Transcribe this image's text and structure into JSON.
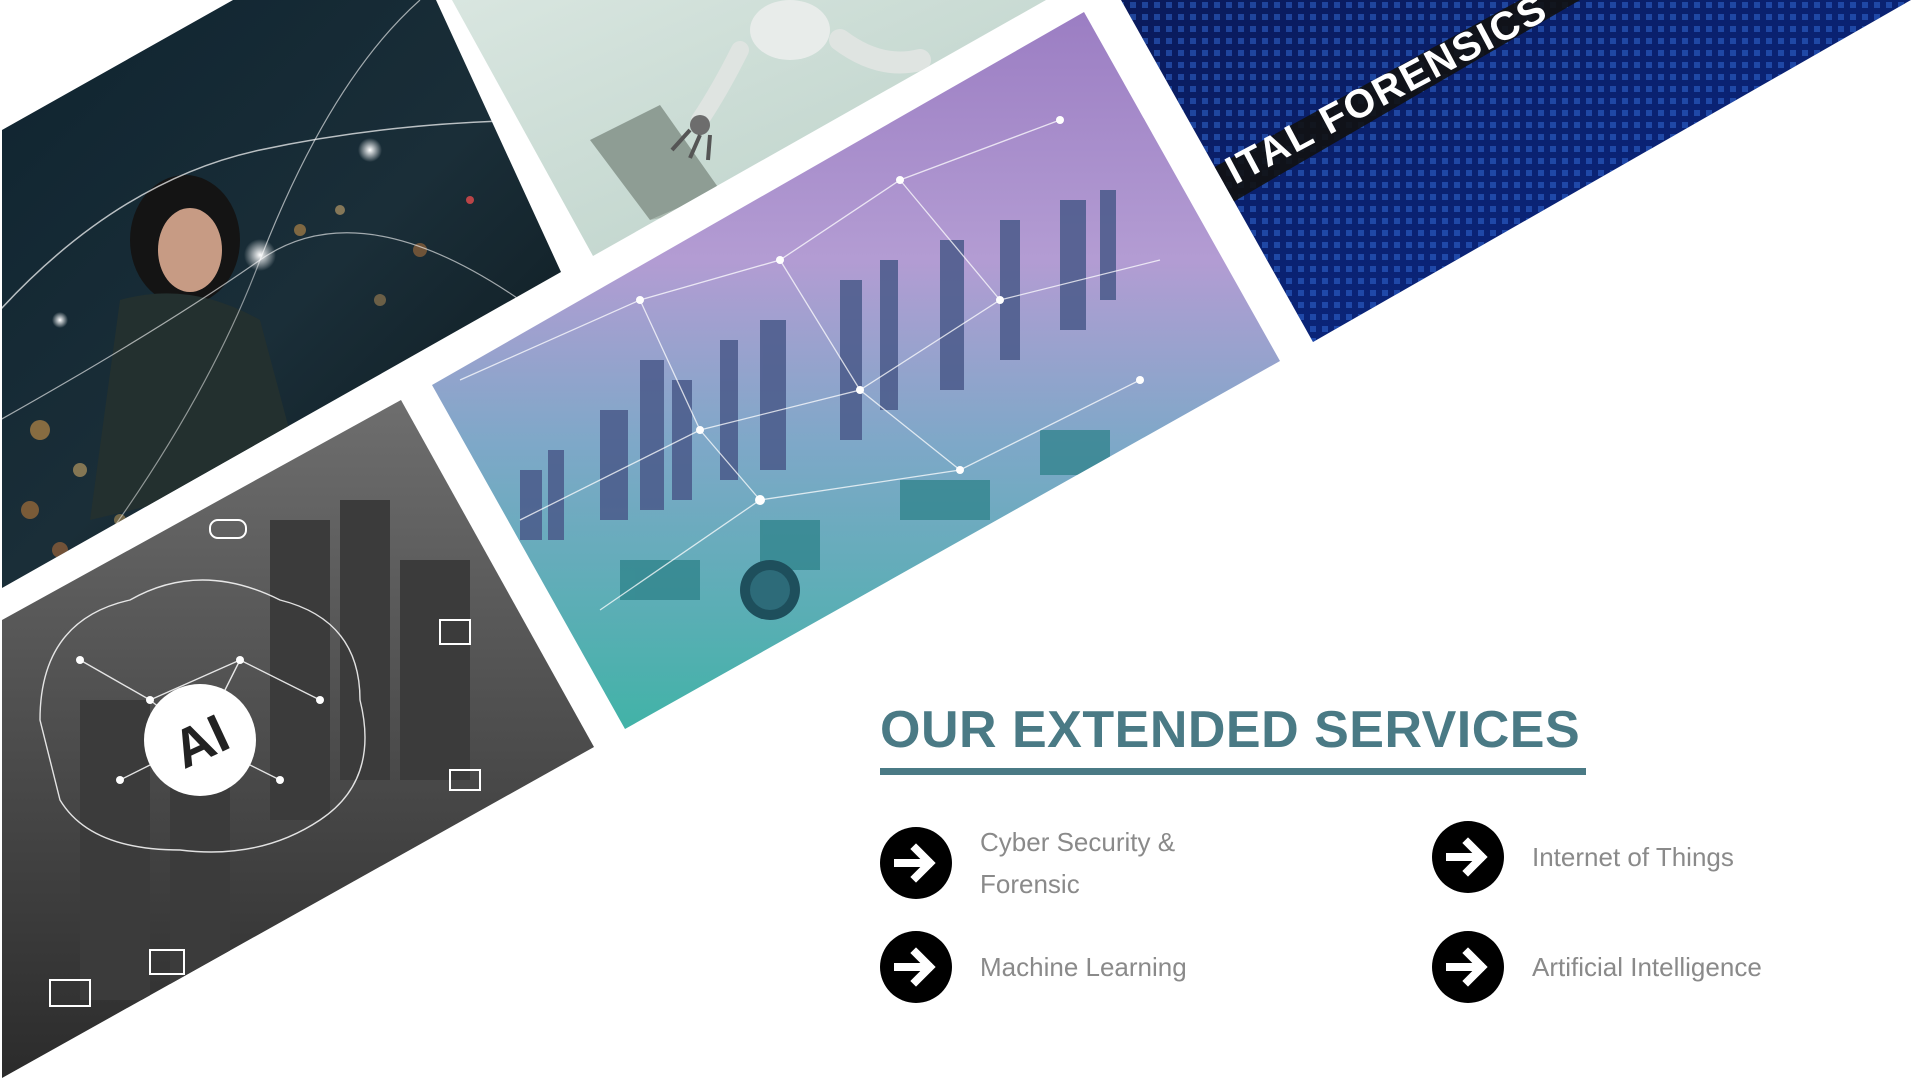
{
  "collage": {
    "panels": [
      {
        "name": "woman-night-city-photo",
        "text": ""
      },
      {
        "name": "robot-laptop-photo",
        "text": ""
      },
      {
        "name": "smart-city-circuit-photo",
        "text": ""
      },
      {
        "name": "digital-forensics-photo",
        "text": "ITAL FORENSICS"
      },
      {
        "name": "ai-brain-city-photo",
        "text": "AI"
      }
    ]
  },
  "services": {
    "title": "OUR EXTENDED SERVICES",
    "accent_color": "#4a7a85",
    "items": [
      {
        "label_line1": "Cyber Security &",
        "label_line2": "Forensic",
        "icon": "arrow-right-circle-icon"
      },
      {
        "label_line1": "Internet of Things",
        "label_line2": "",
        "icon": "arrow-right-circle-icon"
      },
      {
        "label_line1": "Machine Learning",
        "label_line2": "",
        "icon": "arrow-right-circle-icon"
      },
      {
        "label_line1": "Artificial Intelligence",
        "label_line2": "",
        "icon": "arrow-right-circle-icon"
      }
    ]
  }
}
